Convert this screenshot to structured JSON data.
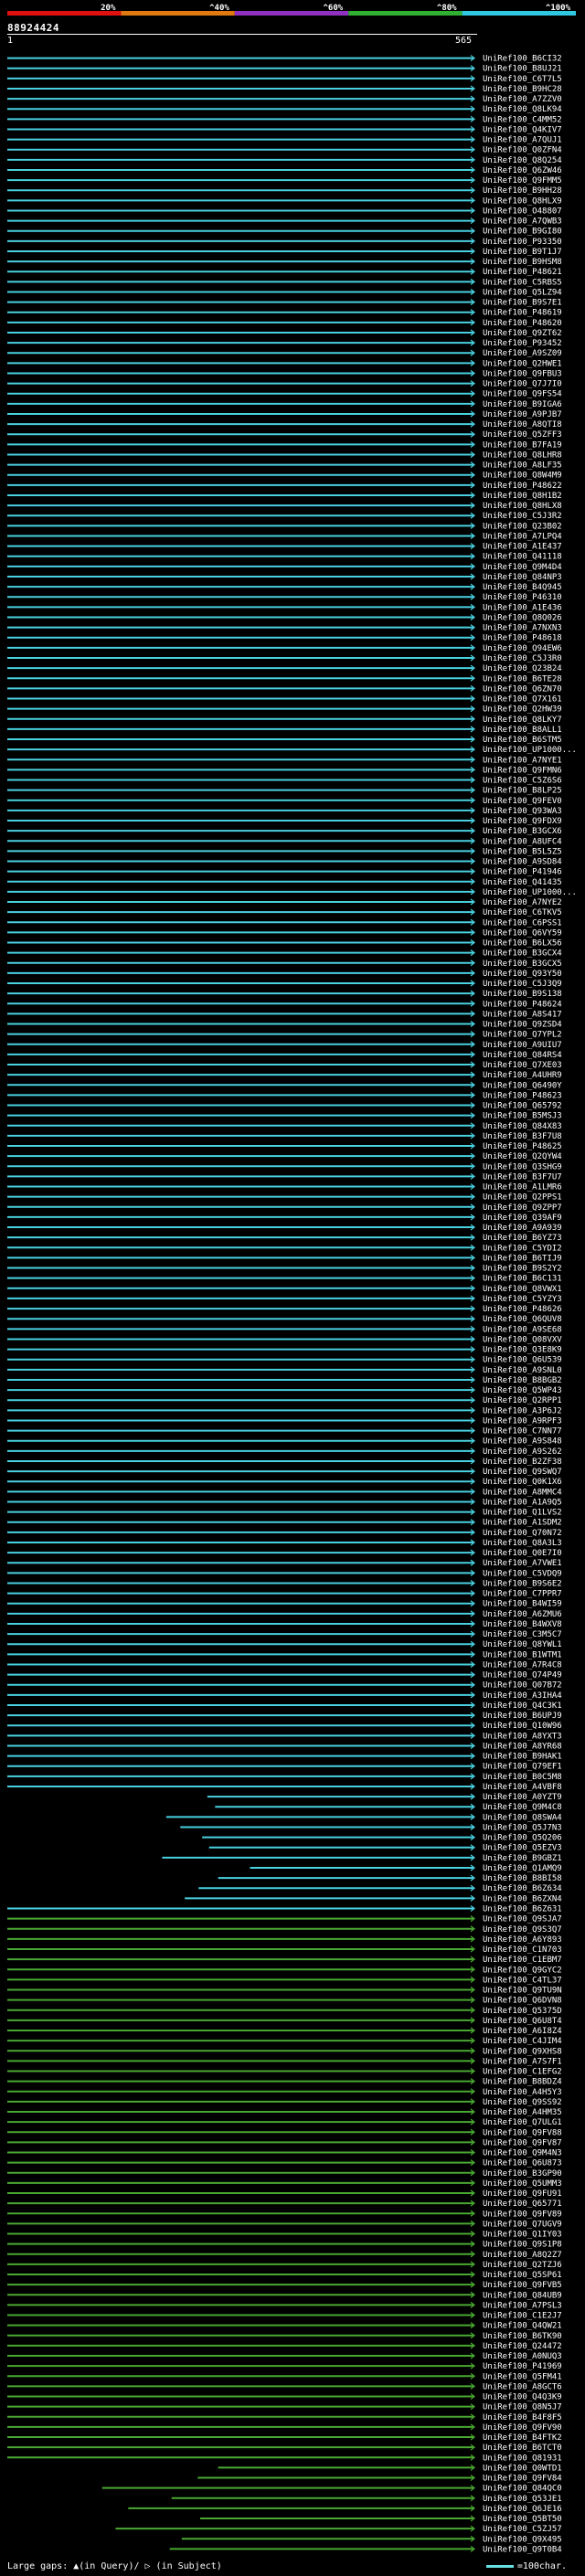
{
  "header": {
    "sequence_id": "88924424",
    "query_start": "1",
    "query_end": "565"
  },
  "legend": {
    "ticks": [
      "20%",
      "^40%",
      "^60%",
      "^80%",
      "^100%"
    ],
    "colors": [
      "#e01010",
      "#e07a10",
      "#9030c0",
      "#30b030",
      "#30c8e0"
    ]
  },
  "footer": {
    "gaps_note": "Large gaps: ▲(in Query)/ ▷ (in Subject)",
    "scale_note": "=100char."
  },
  "colors": {
    "cyan": "#49d1e0",
    "green": "#4aa832",
    "magenta": "#c040c0",
    "background": "#000000"
  },
  "hits": [
    "UniRef100_B6CI32",
    "UniRef100_B8UJ21",
    "UniRef100_C6T7L5",
    "UniRef100_B9HC28",
    "UniRef100_A7ZZV0",
    "UniRef100_Q8LK94",
    "UniRef100_C4MM52",
    "UniRef100_Q4KIV7",
    "UniRef100_A7QUJ1",
    "UniRef100_Q0ZFN4",
    "UniRef100_Q8Q254",
    "UniRef100_Q6ZW46",
    "UniRef100_Q9FMM5",
    "UniRef100_B9HH28",
    "UniRef100_Q8HLX9",
    "UniRef100_O48807",
    "UniRef100_A7QWB3",
    "UniRef100_B9GI80",
    "UniRef100_P93350",
    "UniRef100_B9T1J7",
    "UniRef100_B9HSM8",
    "UniRef100_P48621",
    "UniRef100_C5RBS5",
    "UniRef100_Q5LZ94",
    "UniRef100_B9S7E1",
    "UniRef100_P48619",
    "UniRef100_P48620",
    "UniRef100_Q9ZT62",
    "UniRef100_P93452",
    "UniRef100_A9SZ09",
    "UniRef100_Q2HWE1",
    "UniRef100_Q9FBU3",
    "UniRef100_Q7J7I0",
    "UniRef100_Q9FS54",
    "UniRef100_B9IGA6",
    "UniRef100_A9PJB7",
    "UniRef100_A8QTI8",
    "UniRef100_Q5ZFF3",
    "UniRef100_B7FA19",
    "UniRef100_Q8LHR8",
    "UniRef100_A8LF35",
    "UniRef100_Q8W4M9",
    "UniRef100_P48622",
    "UniRef100_Q8H1B2",
    "UniRef100_Q8HLX8",
    "UniRef100_C5J3R2",
    "UniRef100_Q23B02",
    "UniRef100_A7LPQ4",
    "UniRef100_A1E437",
    "UniRef100_Q41118",
    "UniRef100_Q9M4D4",
    "UniRef100_Q84NP3",
    "UniRef100_B4Q945",
    "UniRef100_P46310",
    "UniRef100_A1E436",
    "UniRef100_Q8Q026",
    "UniRef100_A7NXN3",
    "UniRef100_P48618",
    "UniRef100_Q94EW6",
    "UniRef100_C5J3R0",
    "UniRef100_Q23B24",
    "UniRef100_B6TE28",
    "UniRef100_Q6ZN70",
    "UniRef100_Q7X161",
    "UniRef100_Q2HW39",
    "UniRef100_Q8LKY7",
    "UniRef100_B8ALL1",
    "UniRef100_B6STM5",
    "UniRef100_UP1000...",
    "UniRef100_A7NYE1",
    "UniRef100_Q9FMN6",
    "UniRef100_C5Z6S6",
    "UniRef100_B8LP25",
    "UniRef100_Q9FEV0",
    "UniRef100_Q93WA3",
    "UniRef100_Q9FDX9",
    "UniRef100_B3GCX6",
    "UniRef100_A8UFC4",
    "UniRef100_B5L5Z5",
    "UniRef100_A9SD84",
    "UniRef100_P41946",
    "UniRef100_Q41435",
    "UniRef100_UP1000...",
    "UniRef100_A7NYE2",
    "UniRef100_C6TKV5",
    "UniRef100_C6PSS1",
    "UniRef100_Q6VY59",
    "UniRef100_B6LX56",
    "UniRef100_B3GCX4",
    "UniRef100_B3GCX5",
    "UniRef100_Q93Y50",
    "UniRef100_C5J3Q9",
    "UniRef100_B9S138",
    "UniRef100_P48624",
    "UniRef100_A8S417",
    "UniRef100_Q9ZSD4",
    "UniRef100_Q7YPL2",
    "UniRef100_A9UIU7",
    "UniRef100_Q84RS4",
    "UniRef100_Q7XE03",
    "UniRef100_A4UHR9",
    "UniRef100_Q6490Y",
    "UniRef100_P48623",
    "UniRef100_Q65792",
    "UniRef100_B5MSJ3",
    "UniRef100_Q84X83",
    "UniRef100_B3F7U8",
    "UniRef100_P48625",
    "UniRef100_Q2QYW4",
    "UniRef100_Q3SHG9",
    "UniRef100_B3F7U7",
    "UniRef100_A1LMR6",
    "UniRef100_Q2PPS1",
    "UniRef100_Q9ZPP7",
    "UniRef100_Q39AF9",
    "UniRef100_A9A939",
    "UniRef100_B6YZ73",
    "UniRef100_C5YDI2",
    "UniRef100_B6TIJ9",
    "UniRef100_B9S2Y2",
    "UniRef100_B6C131",
    "UniRef100_Q8VWX1",
    "UniRef100_C5YZY3",
    "UniRef100_P48626",
    "UniRef100_Q6QUV8",
    "UniRef100_A9SE68",
    "UniRef100_Q08VXV",
    "UniRef100_Q3E8K9",
    "UniRef100_Q6U539",
    "UniRef100_A9SNL0",
    "UniRef100_B8BGB2",
    "UniRef100_Q5WP43",
    "UniRef100_Q2RPP1",
    "UniRef100_A3P6J2",
    "UniRef100_A9RPF3",
    "UniRef100_C7NN77",
    "UniRef100_A9S848",
    "UniRef100_A9S262",
    "UniRef100_B2ZF38",
    "UniRef100_Q9SWQ7",
    "UniRef100_Q0K1X6",
    "UniRef100_A8MMC4",
    "UniRef100_A1A9Q5",
    "UniRef100_Q1LVS2",
    "UniRef100_A1SDM2",
    "UniRef100_Q70N72",
    "UniRef100_Q8A3L3",
    "UniRef100_Q0E7I0",
    "UniRef100_A7VWE1",
    "UniRef100_C5VDQ9",
    "UniRef100_B9S6E2",
    "UniRef100_C7PPR7",
    "UniRef100_B4WI59",
    "UniRef100_A6ZMU6",
    "UniRef100_B4WXV8",
    "UniRef100_C3M5C7",
    "UniRef100_Q8YWL1",
    "UniRef100_B1WTM1",
    "UniRef100_A7R4C8",
    "UniRef100_Q74P49",
    "UniRef100_Q07B72",
    "UniRef100_A3IHA4",
    "UniRef100_Q4C3K1",
    "UniRef100_B6UPJ9",
    "UniRef100_Q10W96",
    "UniRef100_A8YXT3",
    "UniRef100_A8YR68",
    "UniRef100_B9HAK1",
    "UniRef100_Q79EF1",
    "UniRef100_B0C5M8",
    "UniRef100_A4VBF8",
    "UniRef100_A0YZT9",
    "UniRef100_Q9M4C8",
    "UniRef100_Q8SWA4",
    "UniRef100_Q5J7N3",
    "UniRef100_Q5Q206",
    "UniRef100_Q5EZV3",
    "UniRef100_B9GBZ1",
    "UniRef100_Q1AMQ9",
    "UniRef100_B8BI58",
    "UniRef100_B6Z634",
    "UniRef100_B6ZXN4",
    "UniRef100_B6Z631",
    "UniRef100_Q9SJA7",
    "UniRef100_Q9S3Q7",
    "UniRef100_A6Y893",
    "UniRef100_C1N703",
    "UniRef100_C1EBM7",
    "UniRef100_Q9GYC2",
    "UniRef100_C4TL37",
    "UniRef100_Q9TU9N",
    "UniRef100_Q6DVN8",
    "UniRef100_Q5375D",
    "UniRef100_Q6U8T4",
    "UniRef100_A6I8Z4",
    "UniRef100_C4JIM4",
    "UniRef100_Q9XHS8",
    "UniRef100_A7S7F1",
    "UniRef100_C1EFG2",
    "UniRef100_B8BDZ4",
    "UniRef100_A4H5Y3",
    "UniRef100_Q9SS92",
    "UniRef100_A4HM35",
    "UniRef100_Q7ULG1",
    "UniRef100_Q9FV88",
    "UniRef100_Q9FV87",
    "UniRef100_Q9M4N3",
    "UniRef100_Q6U873",
    "UniRef100_B3GP90",
    "UniRef100_Q5UMM3",
    "UniRef100_Q9FU91",
    "UniRef100_Q65771",
    "UniRef100_Q9FV89",
    "UniRef100_Q7UGV9",
    "UniRef100_Q1IY03",
    "UniRef100_Q9S1P8",
    "UniRef100_A8Q2Z7",
    "UniRef100_Q2TZJ6",
    "UniRef100_Q5SP61",
    "UniRef100_Q9FVB5",
    "UniRef100_Q84UB9",
    "UniRef100_A7PSL3",
    "UniRef100_C1E2J7",
    "UniRef100_Q4QW21",
    "UniRef100_B6TK90",
    "UniRef100_Q24472",
    "UniRef100_A0NUQ3",
    "UniRef100_P41969",
    "UniRef100_Q5FM41",
    "UniRef100_A8GCT6",
    "UniRef100_Q4Q3K9",
    "UniRef100_Q8N5J7",
    "UniRef100_B4F8F5",
    "UniRef100_Q9FV90",
    "UniRef100_B4FTK2",
    "UniRef100_B6TCT0",
    "UniRef100_Q81931",
    "UniRef100_Q0WTD1",
    "UniRef100_Q9FV84",
    "UniRef100_Q84QC0",
    "UniRef100_Q53JE1",
    "UniRef100_Q6JE16",
    "UniRef100_Q5BT50",
    "UniRef100_C5ZJ57",
    "UniRef100_Q9X495",
    "UniRef100_Q9T0B4"
  ]
}
